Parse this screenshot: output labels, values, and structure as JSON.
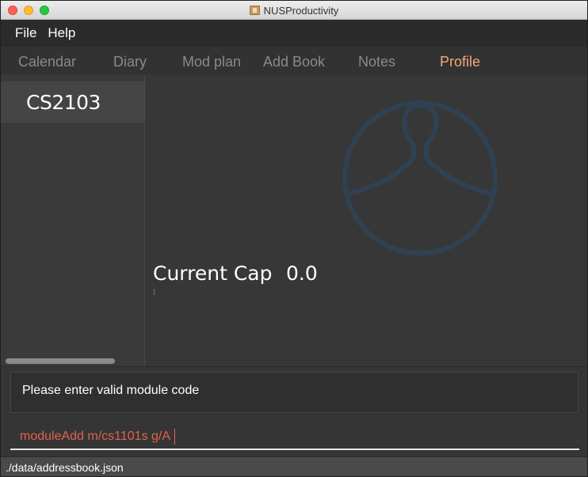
{
  "window": {
    "title": "NUSProductivity"
  },
  "menu": {
    "items": [
      {
        "label": "File"
      },
      {
        "label": "Help"
      }
    ]
  },
  "tabs": [
    {
      "label": "Calendar",
      "active": false
    },
    {
      "label": "Diary",
      "active": false
    },
    {
      "label": "Mod plan",
      "active": false
    },
    {
      "label": "Add Book",
      "active": false
    },
    {
      "label": "Notes",
      "active": false
    },
    {
      "label": "Profile",
      "active": true
    }
  ],
  "sidebar": {
    "modules": [
      {
        "code": "CS2103"
      }
    ]
  },
  "profile": {
    "avatar_icon": "user-silhouette-icon",
    "cap_label": "Current Cap",
    "cap_value": "0.0"
  },
  "result": {
    "message": "Please enter valid module code"
  },
  "command": {
    "value": "moduleAdd m/cs1101s g/A"
  },
  "status": {
    "path": "./data/addressbook.json"
  },
  "colors": {
    "active_tab": "#f4a779",
    "command_text": "#e2614f",
    "avatar_stroke": "#2f4152"
  }
}
